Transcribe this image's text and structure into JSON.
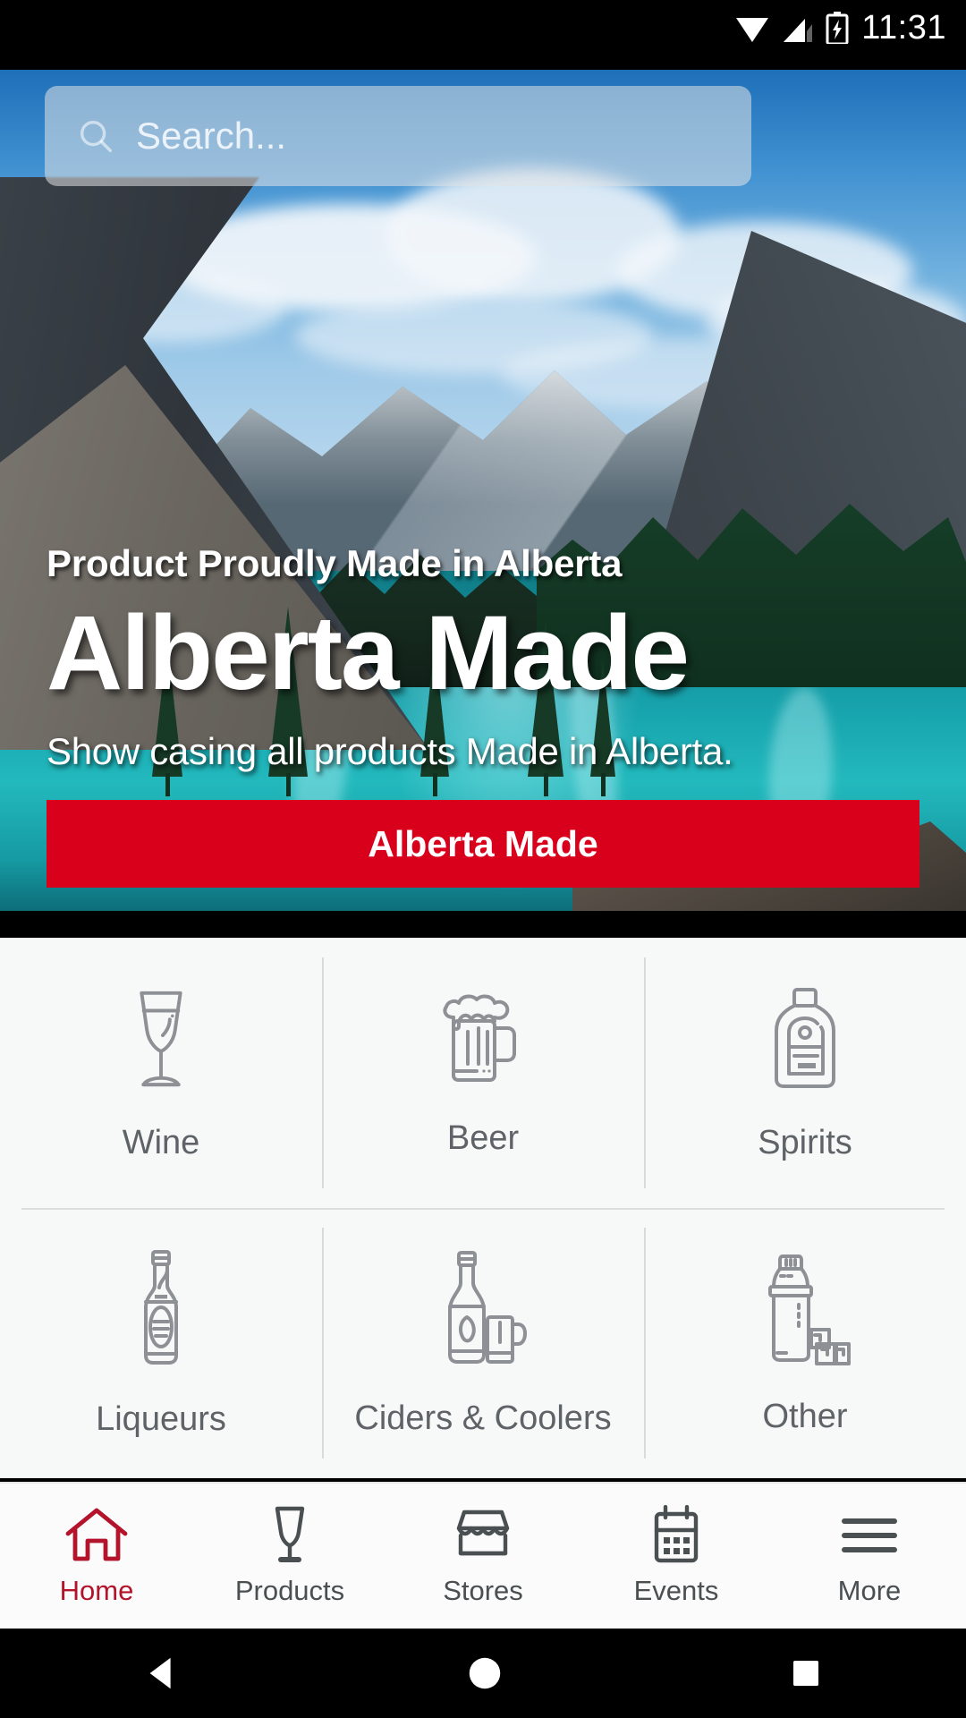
{
  "statusbar": {
    "time": "11:31",
    "icons": [
      "wifi-icon",
      "cellular-signal-icon",
      "battery-charging-icon"
    ]
  },
  "search": {
    "placeholder": "Search...",
    "value": "",
    "icon": "search-icon"
  },
  "hero": {
    "eyebrow": "Product Proudly Made in Alberta",
    "title": "Alberta Made",
    "subtitle": "Show casing all products Made in Alberta.",
    "cta_label": "Alberta Made",
    "cta_color": "#D9001B",
    "image_alt": "mountain-lake-photo"
  },
  "categories": {
    "rows": [
      [
        {
          "label": "Wine",
          "icon": "wine-glass-icon"
        },
        {
          "label": "Beer",
          "icon": "beer-mug-icon"
        },
        {
          "label": "Spirits",
          "icon": "spirits-bottle-icon"
        }
      ],
      [
        {
          "label": "Liqueurs",
          "icon": "liqueur-bottle-icon"
        },
        {
          "label": "Ciders & Coolers",
          "icon": "cider-bottle-mug-icon"
        },
        {
          "label": "Other",
          "icon": "cocktail-shaker-icon"
        }
      ]
    ]
  },
  "tabbar": {
    "active_color": "#B3132B",
    "items": [
      {
        "label": "Home",
        "icon": "home-icon",
        "active": true
      },
      {
        "label": "Products",
        "icon": "wine-glass-icon",
        "active": false
      },
      {
        "label": "Stores",
        "icon": "storefront-icon",
        "active": false
      },
      {
        "label": "Events",
        "icon": "calendar-icon",
        "active": false
      },
      {
        "label": "More",
        "icon": "hamburger-menu-icon",
        "active": false
      }
    ]
  },
  "androidnav": {
    "back": "back-triangle-icon",
    "home": "home-circle-icon",
    "recents": "recents-square-icon"
  }
}
